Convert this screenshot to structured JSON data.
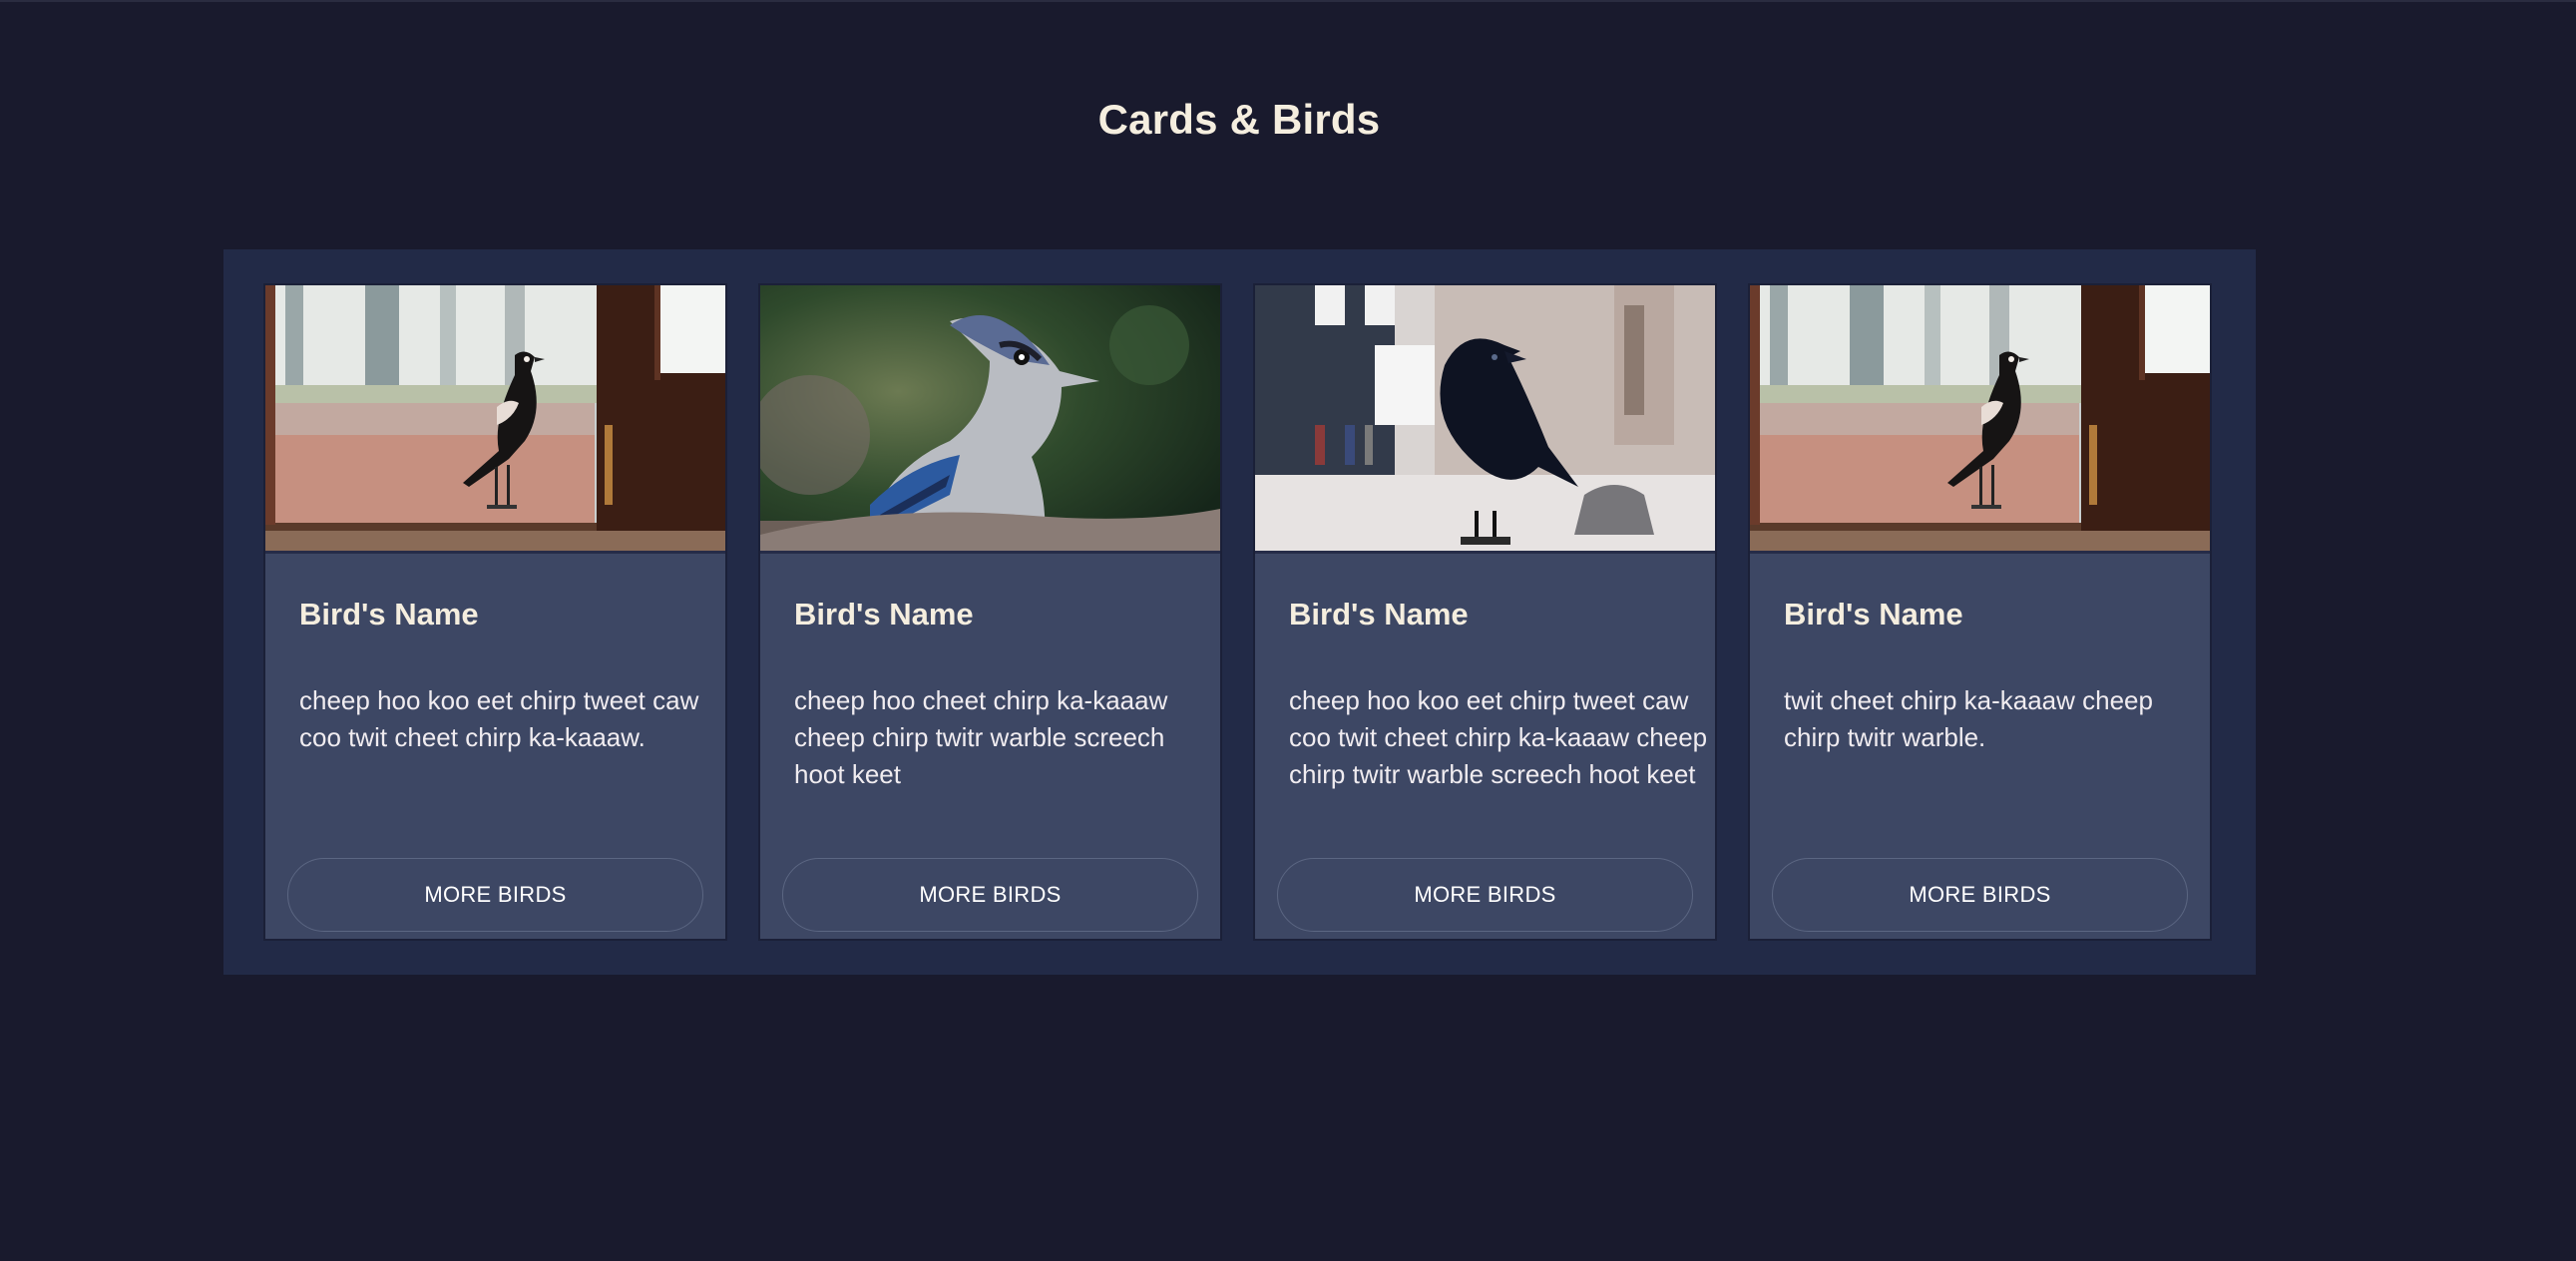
{
  "page": {
    "title": "Cards & Birds"
  },
  "colors": {
    "background": "#191a2d",
    "panel": "#222a47",
    "card": "#3d4764",
    "title_text": "#f5eedf"
  },
  "cards": [
    {
      "image": "magpie-on-doorstep-photo",
      "title": "Bird's Name",
      "text": "cheep hoo koo eet chirp tweet caw coo twit cheet chirp ka-kaaaw.",
      "button": "MORE BIRDS"
    },
    {
      "image": "blue-jay-photo",
      "title": "Bird's Name",
      "text": "cheep hoo cheet chirp ka-kaaaw cheep chirp twitr warble screech hoot keet",
      "button": "MORE BIRDS"
    },
    {
      "image": "crow-on-street-photo",
      "title": "Bird's Name",
      "text": "cheep hoo koo eet chirp tweet caw coo twit cheet chirp ka-kaaaw cheep chirp twitr warble screech hoot keet",
      "button": "MORE BIRDS"
    },
    {
      "image": "magpie-on-doorstep-photo",
      "title": "Bird's Name",
      "text": "twit cheet chirp ka-kaaaw cheep chirp twitr warble.",
      "button": "MORE BIRDS"
    }
  ]
}
